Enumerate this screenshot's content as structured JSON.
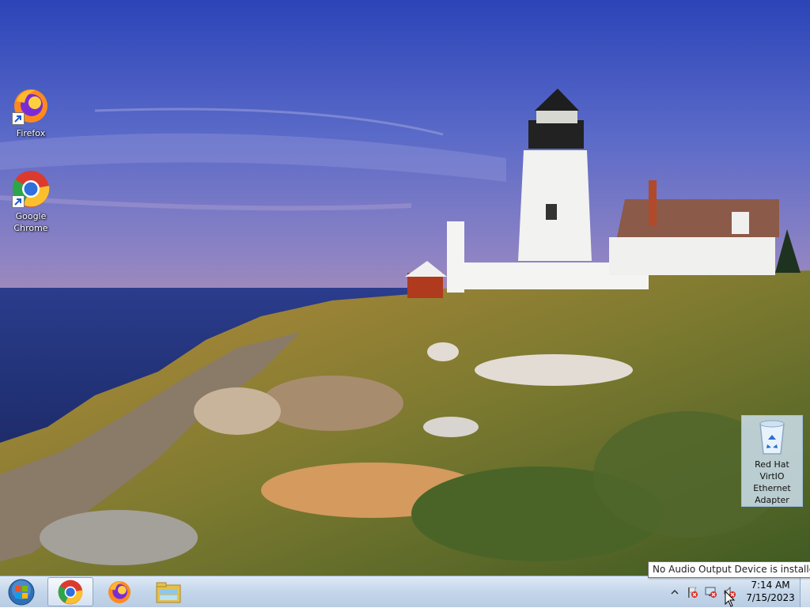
{
  "desktop": {
    "icons": [
      {
        "label": "Firefox",
        "icon": "firefox-icon"
      },
      {
        "label": "Google Chrome",
        "icon": "chrome-icon"
      }
    ],
    "recycle_bin": {
      "label": "Red Hat VirtIO Ethernet Adapter",
      "icon": "recycle-bin-icon"
    }
  },
  "taskbar": {
    "start_icon": "windows-start-icon",
    "pinned": [
      {
        "icon": "chrome-icon",
        "active": true
      },
      {
        "icon": "firefox-icon",
        "active": false
      },
      {
        "icon": "file-explorer-icon",
        "active": false
      }
    ],
    "tray": {
      "icons": [
        "show-hidden-icons-chevron",
        "action-center-flag-icon",
        "network-disconnected-icon",
        "volume-muted-icon"
      ],
      "time": "7:14 AM",
      "date": "7/15/2023"
    },
    "tooltip": "No Audio Output Device is installed."
  }
}
